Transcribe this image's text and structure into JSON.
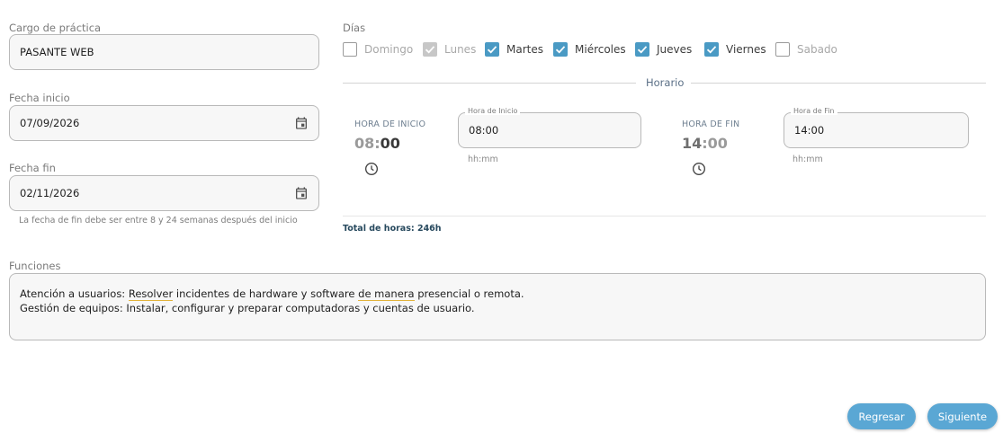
{
  "form": {
    "cargo_label": "Cargo de práctica",
    "cargo_value": "PASANTE WEB",
    "fecha_inicio_label": "Fecha inicio",
    "fecha_inicio_value": "07/09/2026",
    "fecha_fin_label": "Fecha fin",
    "fecha_fin_value": "02/11/2026",
    "fecha_fin_hint": "La fecha de fin debe ser entre 8 y 24 semanas después del inicio"
  },
  "dias": {
    "label": "Días",
    "items": [
      {
        "label": "Domingo",
        "state": "unchecked"
      },
      {
        "label": "Lunes",
        "state": "checked-disabled"
      },
      {
        "label": "Martes",
        "state": "checked"
      },
      {
        "label": "Miércoles",
        "state": "checked"
      },
      {
        "label": "Jueves",
        "state": "checked"
      },
      {
        "label": "Viernes",
        "state": "checked"
      },
      {
        "label": "Sabado",
        "state": "unchecked"
      }
    ]
  },
  "horario": {
    "title": "Horario",
    "inicio": {
      "head": "HORA DE INICIO",
      "hour": "08",
      "minute": "00",
      "input_label": "Hora de Inicio",
      "input_value": "08:00",
      "format_hint": "hh:mm"
    },
    "fin": {
      "head": "HORA DE FIN",
      "hour": "14",
      "minute": "00",
      "input_label": "Hora de Fin",
      "input_value": "14:00",
      "format_hint": "hh:mm"
    },
    "total": "Total de horas: 246h"
  },
  "funciones": {
    "label": "Funciones",
    "line1_a": "Atención a usuarios: ",
    "line1_b": "Resolver",
    "line1_c": " incidentes de hardware y software ",
    "line1_d": "de manera",
    "line1_e": " presencial o remota.",
    "line2": "Gestión de equipos: Instalar, configurar y preparar computadoras y cuentas de usuario."
  },
  "actions": {
    "back_label": "Regresar",
    "next_label": "Siguiente"
  },
  "colors": {
    "accent": "#4a9ac4",
    "button": "#5aa7d4",
    "squiggle": "#e2b33b"
  }
}
